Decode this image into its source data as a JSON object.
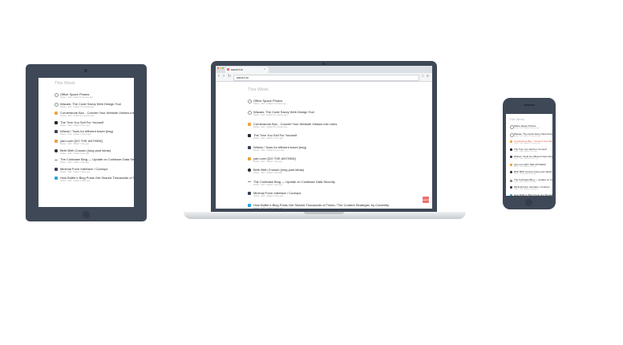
{
  "heading": "This Week",
  "browser": {
    "tab_title": "saved.io",
    "url": "saved.io",
    "badge": "saved"
  },
  "items": [
    {
      "title": "Office Space Photos",
      "meta": "Delete · Edit · Added 9 minutes ago",
      "icon": "circle-icon",
      "color": "#999999"
    },
    {
      "title": "Wacaw: The Code Savvy Web Design Tool",
      "meta": "Delete · Edit · Added 10 minutes ago",
      "icon": "circle-icon",
      "color": "#999999"
    },
    {
      "title": "Cornerstone Box - Convert Your Website Visitors into Likes",
      "meta": "Delete · Edit · Added 25 minutes ago",
      "icon": "flame-icon",
      "color": "#f2a33b"
    },
    {
      "title": "The Tree You Sell For Yourself",
      "meta": "Delete · Edit · Added 1 hour ago",
      "icon": "owl-icon",
      "color": "#222a35"
    },
    {
      "title": "Wheat / Tools for efficient travel (beg)",
      "meta": "Delete · Edit · Added 4 hours ago",
      "icon": "bird-icon",
      "color": "#3a4454"
    },
    {
      "title": "yarn.com [DO THE ANTHEM]",
      "meta": "Delete · Edit · Added 1 day ago",
      "icon": "cup-icon",
      "color": "#e8a33d"
    },
    {
      "title": "Birth Birth Crossm (long post ideas)",
      "meta": "Delete · Edit · Added 1 day ago",
      "icon": "dot-icon",
      "color": "#2b2b2b"
    },
    {
      "title": "The Coinbase Blog — Update on Coinbase Data Security",
      "meta": "Delete · Edit · Added 1 day ago",
      "icon": "dash-icon",
      "color": "#7d8790"
    },
    {
      "title": "Minimal Form Interface / Codrops",
      "meta": "Delete · Edit · Added 2 days ago",
      "icon": "square-icon",
      "color": "#3a4454"
    },
    {
      "title": "How Buffer's Blog Posts Get Shared Thousands of Times / The Content Strategist, by Contently",
      "meta": "Delete · Edit · Added 2 days ago",
      "icon": "square-icon",
      "color": "#2aa4d9"
    }
  ]
}
